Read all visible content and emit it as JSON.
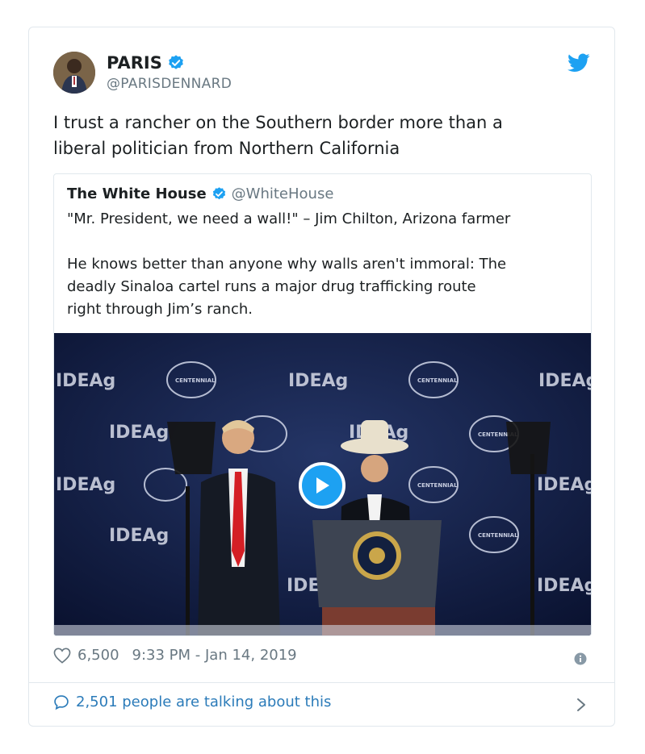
{
  "tweet": {
    "author_name": "PARIS",
    "author_handle": "@PARISDENNARD",
    "text_line1": "I trust a rancher on the Southern border more than a",
    "text_line2": "liberal politician from Northern California",
    "likes": "6,500",
    "timestamp": "9:33 PM - Jan 14, 2019",
    "talking": "2,501 people are talking about this"
  },
  "quoted": {
    "name": "The White House",
    "handle": "@WhiteHouse",
    "line1": "\"Mr. President, we need a wall!\" – Jim Chilton, Arizona farmer",
    "line2": "He knows better than anyone why walls aren't immoral: The",
    "line3": "deadly Sinaloa cartel runs a major drug trafficking route",
    "line4": "right through Jim’s ranch."
  },
  "media": {
    "backdrop_logo": "IDEAg",
    "seal_text": "CENTENNIAL"
  },
  "icons": {
    "verified": "verified-badge-icon",
    "bird": "twitter-bird-icon",
    "heart": "heart-icon",
    "info": "info-icon",
    "reply": "speech-bubble-icon",
    "chevron": "chevron-right-icon",
    "play": "play-icon"
  },
  "colors": {
    "accent": "#1da1f2",
    "link": "#2b7bb9",
    "muted": "#697882",
    "border": "#e1e8ed"
  }
}
